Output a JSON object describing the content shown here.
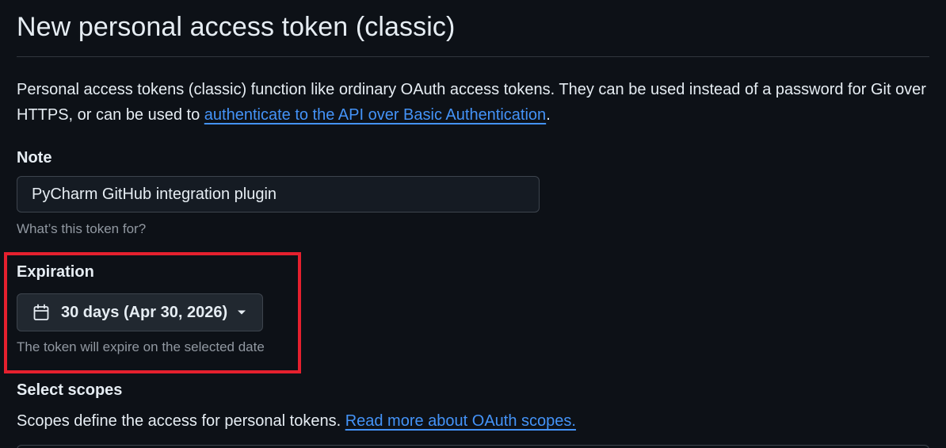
{
  "page": {
    "title": "New personal access token (classic)"
  },
  "intro": {
    "text_before": "Personal access tokens (classic) function like ordinary OAuth access tokens. They can be used instead of a password for Git over HTTPS, or can be used to ",
    "link_text": "authenticate to the API over Basic Authentication",
    "text_after": "."
  },
  "note": {
    "label": "Note",
    "value": "PyCharm GitHub integration plugin",
    "hint": "What’s this token for?"
  },
  "expiration": {
    "label": "Expiration",
    "selected": "30 days (Apr 30, 2026)",
    "icon": "calendar-icon",
    "dropdown_icon": "triangle-down-icon",
    "hint": "The token will expire on the selected date",
    "highlight_color": "#e5202e"
  },
  "scopes": {
    "label": "Select scopes",
    "text": "Scopes define the access for personal tokens. ",
    "link_text": "Read more about OAuth scopes."
  },
  "colors": {
    "background": "#0d1117",
    "text": "#e6edf3",
    "muted": "#9198a1",
    "link": "#4493f8",
    "border": "#3d444d"
  }
}
